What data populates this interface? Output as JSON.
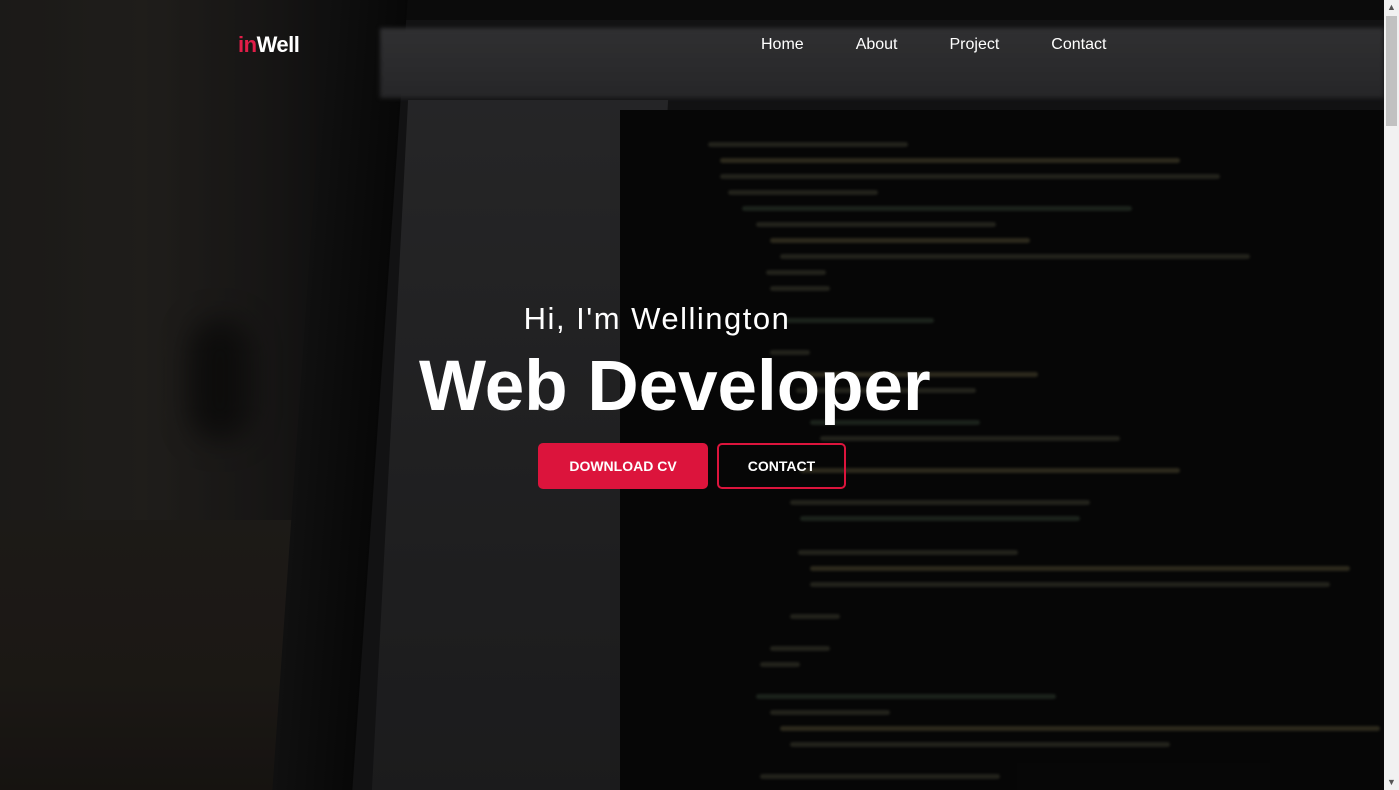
{
  "brand": {
    "prefix": "in",
    "name": "Well"
  },
  "nav": {
    "items": [
      "Home",
      "About",
      "Project",
      "Contact"
    ]
  },
  "hero": {
    "greeting": "Hi, I'm Wellington",
    "title": "Web Developer",
    "primary_button": "DOWNLOAD CV",
    "secondary_button": "CONTACT"
  },
  "colors": {
    "accent": "#dc143c",
    "text": "#ffffff",
    "background": "#0b0b0b"
  },
  "icons": {
    "scroll_up": "chevron-up-icon",
    "scroll_down": "chevron-down-icon"
  }
}
